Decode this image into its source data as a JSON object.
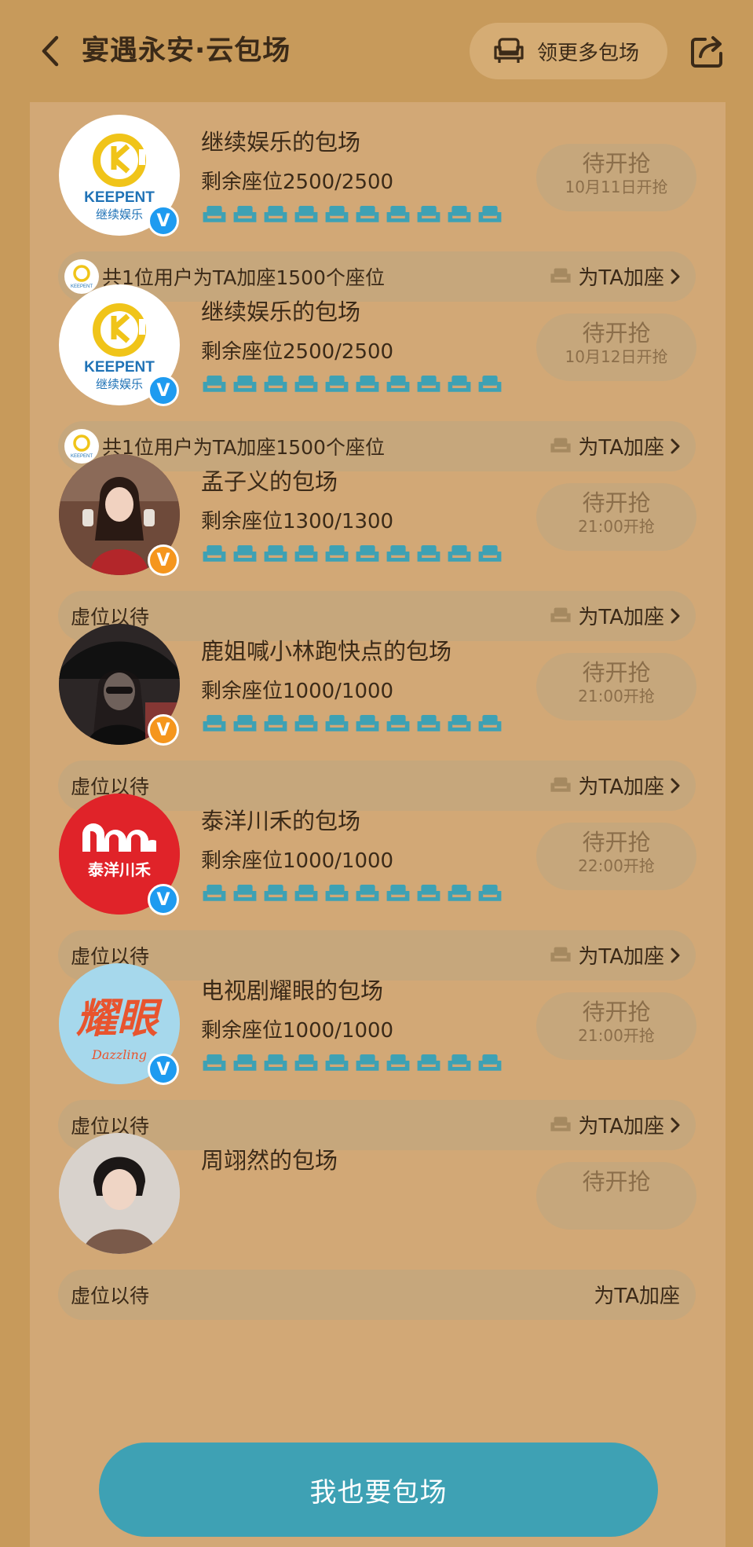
{
  "header": {
    "title": "宴遇永安·云包场",
    "more_button": "领更多包场"
  },
  "theme": {
    "background": "#c79a5b",
    "card": "#d2a876",
    "accent": "#3ea1b4",
    "seat_color": "#3ea1b4"
  },
  "cards": [
    {
      "name": "继续娱乐的包场",
      "seats": "剩余座位2500/2500",
      "button": "待开抢",
      "time": "10月11日开抢",
      "supporters": "共1位用户为TA加座1500个座位",
      "add_seat": "为TA加座",
      "avatar_text": "KEEPENT",
      "avatar_subtext": "继续娱乐",
      "verify": "blue"
    },
    {
      "name": "继续娱乐的包场",
      "seats": "剩余座位2500/2500",
      "button": "待开抢",
      "time": "10月12日开抢",
      "supporters": "共1位用户为TA加座1500个座位",
      "add_seat": "为TA加座",
      "avatar_text": "KEEPENT",
      "avatar_subtext": "继续娱乐",
      "verify": "blue"
    },
    {
      "name": "孟子义的包场",
      "seats": "剩余座位1300/1300",
      "button": "待开抢",
      "time": "21:00开抢",
      "supporters": "虚位以待",
      "add_seat": "为TA加座",
      "verify": "orange"
    },
    {
      "name": "鹿姐喊小林跑快点的包场",
      "seats": "剩余座位1000/1000",
      "button": "待开抢",
      "time": "21:00开抢",
      "supporters": "虚位以待",
      "add_seat": "为TA加座",
      "verify": "orange"
    },
    {
      "name": "泰洋川禾的包场",
      "seats": "剩余座位1000/1000",
      "button": "待开抢",
      "time": "22:00开抢",
      "supporters": "虚位以待",
      "add_seat": "为TA加座",
      "avatar_text": "泰洋川禾",
      "verify": "blue"
    },
    {
      "name": "电视剧耀眼的包场",
      "seats": "剩余座位1000/1000",
      "button": "待开抢",
      "time": "21:00开抢",
      "supporters": "虚位以待",
      "add_seat": "为TA加座",
      "avatar_text": "耀眼",
      "avatar_subtext": "Dazzling",
      "verify": "blue"
    },
    {
      "name": "周翊然的包场",
      "button": "待开抢",
      "supporters": "虚位以待",
      "add_seat": "为TA加座"
    }
  ],
  "cta_button": "我也要包场"
}
